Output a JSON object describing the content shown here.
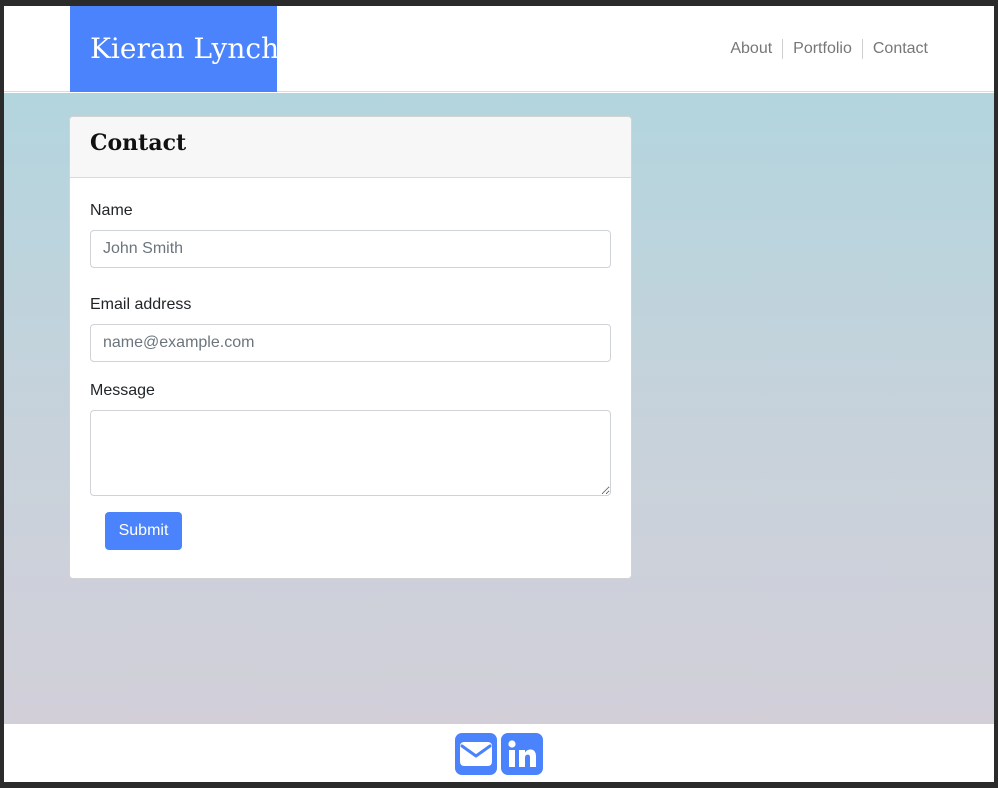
{
  "brand": {
    "name": "Kieran Lynch"
  },
  "nav": {
    "items": [
      "About",
      "Portfolio",
      "Contact"
    ]
  },
  "contact_card": {
    "title": "Contact",
    "name_label": "Name",
    "name_placeholder": "John Smith",
    "email_label": "Email address",
    "email_placeholder": "name@example.com",
    "message_label": "Message",
    "message_value": "",
    "submit_label": "Submit"
  },
  "footer": {
    "icons": [
      "envelope-icon",
      "linkedin-icon"
    ]
  },
  "colors": {
    "accent": "#4a83fb",
    "gradient_top": "#b3d5de",
    "gradient_bottom": "#d2cfd9",
    "nav_text": "#777777"
  }
}
